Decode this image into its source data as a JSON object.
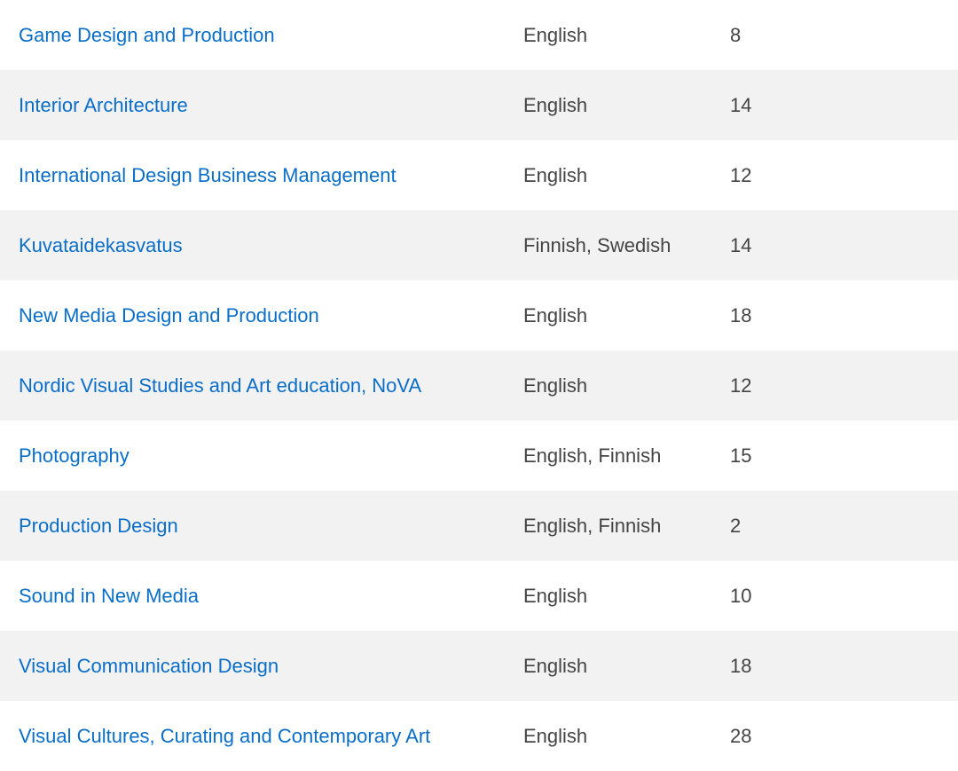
{
  "programmes": [
    {
      "name": "Game Design and Production",
      "language": "English",
      "count": "8"
    },
    {
      "name": "Interior Architecture",
      "language": "English",
      "count": "14"
    },
    {
      "name": "International Design Business Management",
      "language": "English",
      "count": "12"
    },
    {
      "name": "Kuvataidekasvatus",
      "language": "Finnish, Swedish",
      "count": "14"
    },
    {
      "name": "New Media Design and Production",
      "language": "English",
      "count": "18"
    },
    {
      "name": "Nordic Visual Studies and Art education, NoVA",
      "language": "English",
      "count": "12"
    },
    {
      "name": "Photography",
      "language": "English, Finnish",
      "count": "15"
    },
    {
      "name": "Production Design",
      "language": "English, Finnish",
      "count": "2"
    },
    {
      "name": "Sound in New Media",
      "language": "English",
      "count": "10"
    },
    {
      "name": "Visual Communication Design",
      "language": "English",
      "count": "18"
    },
    {
      "name": "Visual Cultures, Curating and Contemporary Art",
      "language": "English",
      "count": "28"
    }
  ],
  "colors": {
    "link": "#0a6ec8",
    "text": "#444444",
    "row_alt": "#f2f2f2"
  }
}
